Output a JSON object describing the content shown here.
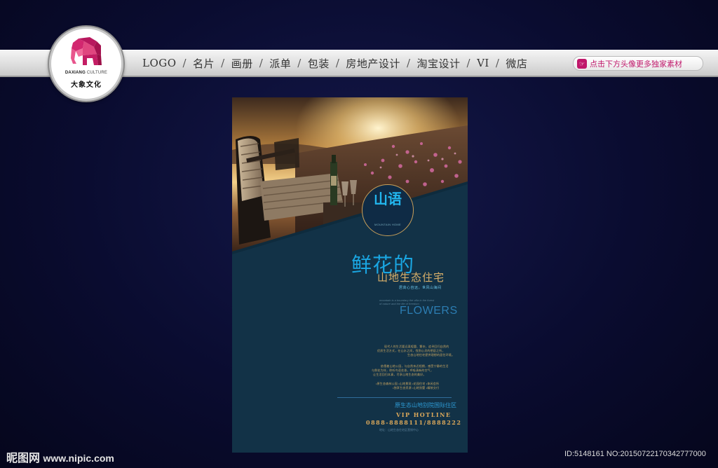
{
  "nav": {
    "items": [
      "LOGO",
      "名片",
      "画册",
      "派单",
      "包装",
      "房地产设计",
      "淘宝设计",
      "VI",
      "微店"
    ],
    "separator": "/",
    "promo": "点击下方头像更多独家素材"
  },
  "logo": {
    "en_bold": "DAXIANG",
    "en_rest": " CULTURE",
    "cn": "大象文化"
  },
  "poster": {
    "brand_cn": "山语",
    "brand_en": "MOUNTAIN HOME",
    "headline1": "鲜花的",
    "headline2": "山地生态住宅",
    "tagline": "居高心自远，世风山海间",
    "en_line1": "mountain is a boundary the villa in the forest",
    "en_line2": "of nature and the life of freedom",
    "flowers": "FLOWERS",
    "body": [
      "现代人的生活要远离喧嚣、繁杂，追寻回归自然的",
      "优质生活方式，在山水之间，找到心灵的栖居之所，",
      "生态山地住宅提供理想的居住环境。",
      "",
      "依偎着山地公园，与自然亲近相拥，感受宁静的生活",
      "与鲜花为伴，聆听鸟语花香，呼吸清新的空气，",
      "让生活回归本真，尽享山地生态的美好。",
      "•原生态森林公园 •山地景观 •花园住宅 •休闲会所",
      "•独享生态资源 •山地别墅 •精装交付"
    ],
    "project": "原生态山地别院国际住区",
    "vip": "VIP HOTLINE",
    "phone": "0888-8888111/8888222",
    "fine": "地址：山地生态住宅区营销中心"
  },
  "watermark": {
    "left_brand": "昵图网",
    "left_site": "www.nipic.com",
    "right": "ID:5148161 NO:20150722170342777000"
  },
  "colors": {
    "background": "#0b0d33",
    "poster": "#123247",
    "accent_blue": "#1aa6e2",
    "accent_gold": "#d9b06a",
    "promo": "#c0186b"
  }
}
